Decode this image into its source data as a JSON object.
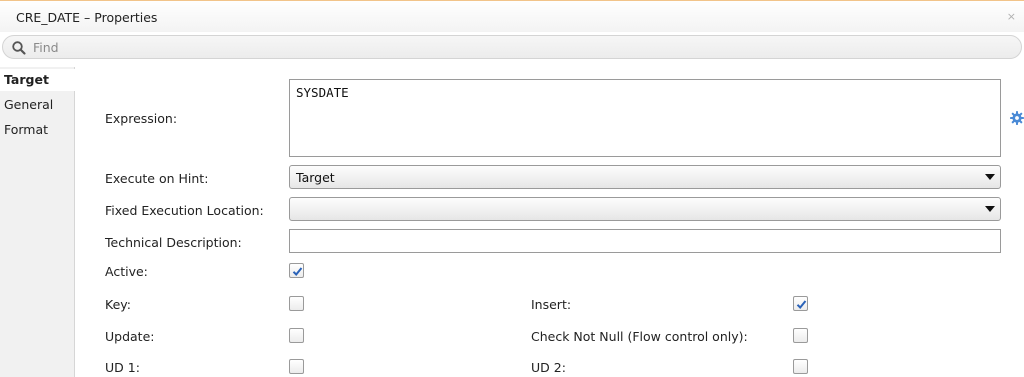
{
  "window": {
    "title": "CRE_DATE – Properties",
    "close_glyph": "×"
  },
  "search": {
    "placeholder": "Find",
    "value": ""
  },
  "sidebar": {
    "tabs": [
      {
        "label": "Target",
        "active": true
      },
      {
        "label": "General",
        "active": false
      },
      {
        "label": "Format",
        "active": false
      }
    ]
  },
  "form": {
    "expression": {
      "label": "Expression:",
      "value": "SYSDATE",
      "action_icon": "gear-icon"
    },
    "execute_on_hint": {
      "label": "Execute on Hint:",
      "value": "Target"
    },
    "fixed_execution_location": {
      "label": "Fixed Execution Location:",
      "value": ""
    },
    "technical_description": {
      "label": "Technical Description:",
      "value": ""
    },
    "checkboxes": {
      "active": {
        "label": "Active:",
        "checked": true
      },
      "key": {
        "label": "Key:",
        "checked": false
      },
      "insert": {
        "label": "Insert:",
        "checked": true
      },
      "update": {
        "label": "Update:",
        "checked": false
      },
      "check_not_null": {
        "label": "Check Not Null (Flow control only):",
        "checked": false
      },
      "ud1": {
        "label": "UD 1:",
        "checked": false
      },
      "ud2": {
        "label": "UD 2:",
        "checked": false
      }
    }
  },
  "colors": {
    "accent_border": "#f2c48a",
    "checkmark": "#2a62b8",
    "gear": "#4a8ad6"
  }
}
